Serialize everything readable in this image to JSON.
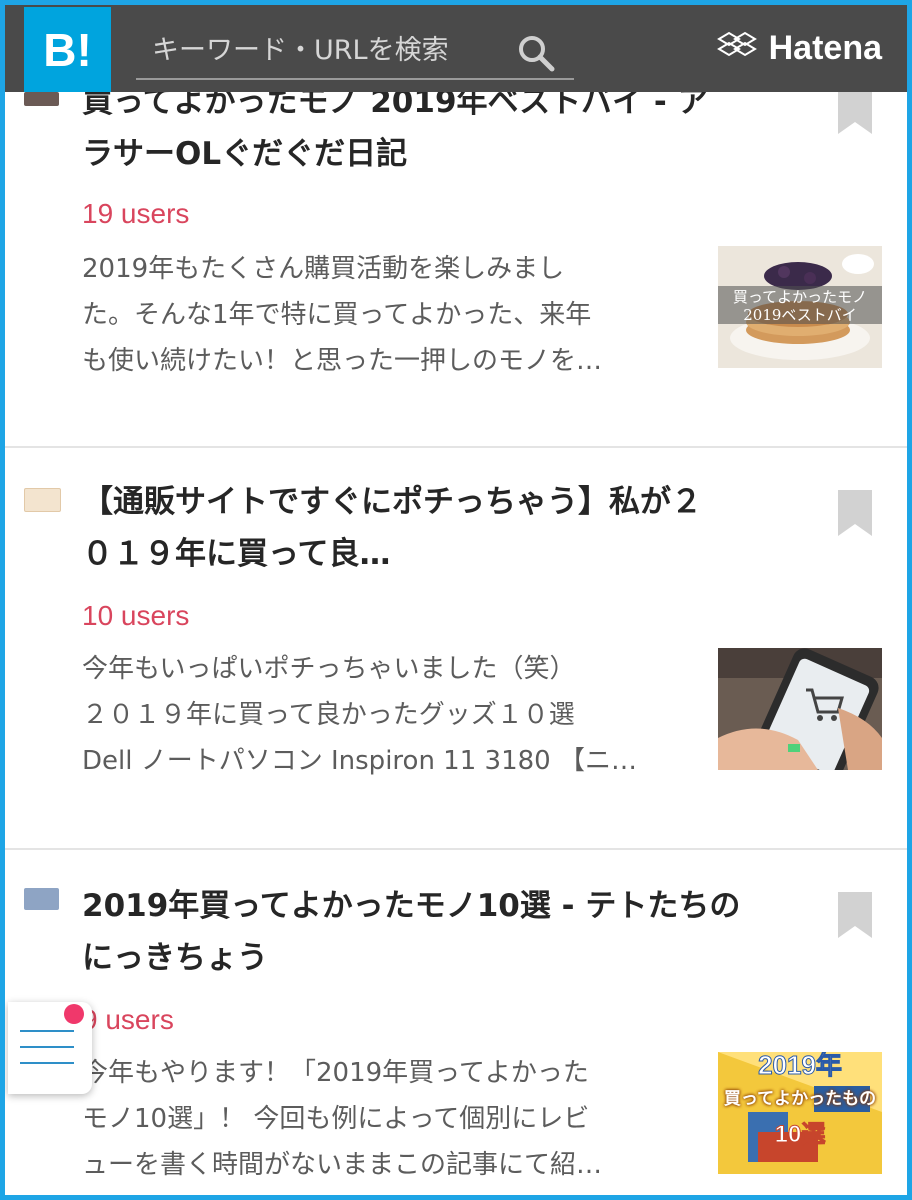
{
  "header": {
    "logo_text": "B!",
    "search_placeholder": "キーワード・URLを検索",
    "brand_name": "Hatena",
    "bg_color": "#4a4a4a",
    "logo_color": "#00a4de"
  },
  "entries": [
    {
      "title_line1": "買ってよかったモノ 2019年ベストバイ - ア",
      "title_line2": "ラサーOLぐだぐだ日記",
      "users": "19 users",
      "desc_line1": "2019年もたくさん購買活動を楽しみまし",
      "desc_line2": "た。そんな1年で特に買ってよかった、来年",
      "desc_line3": "も使い続けたい！と思った一押しのモノを…",
      "thumb_caption_line1": "買ってよかったモノ",
      "thumb_caption_line2": "2019ベストバイ",
      "thumb_icon": "pancake-photo"
    },
    {
      "title_line1": "【通販サイトですぐにポチっちゃう】私が２",
      "title_line2": "０１９年に買って良…",
      "users": "10 users",
      "desc_line1": "今年もいっぱいポチっちゃいました（笑）",
      "desc_line2": "２０１９年に買って良かったグッズ１０選",
      "desc_line3": "Dell ノートパソコン Inspiron 11 3180 【ニ…",
      "thumb_icon": "smartphone-shopping-cart-photo"
    },
    {
      "title_line1": "2019年買ってよかったモノ10選 - テトたちの",
      "title_line2": "にっきちょう",
      "users": "9 users",
      "desc_line1": "今年もやります！「2019年買ってよかった",
      "desc_line2": "モノ10選」！ 今回も例によって個別にレビ",
      "desc_line3": "ューを書く時間がないままこの記事にて紹…",
      "thumb_caption_line1": "2019年",
      "thumb_caption_line2": "買ってよかったもの",
      "thumb_caption_line3": "10選",
      "thumb_icon": "gadgets-collage-photo"
    }
  ],
  "colors": {
    "users": "#d9455d",
    "frame": "#1ea5e6",
    "notification": "#f0386b"
  }
}
